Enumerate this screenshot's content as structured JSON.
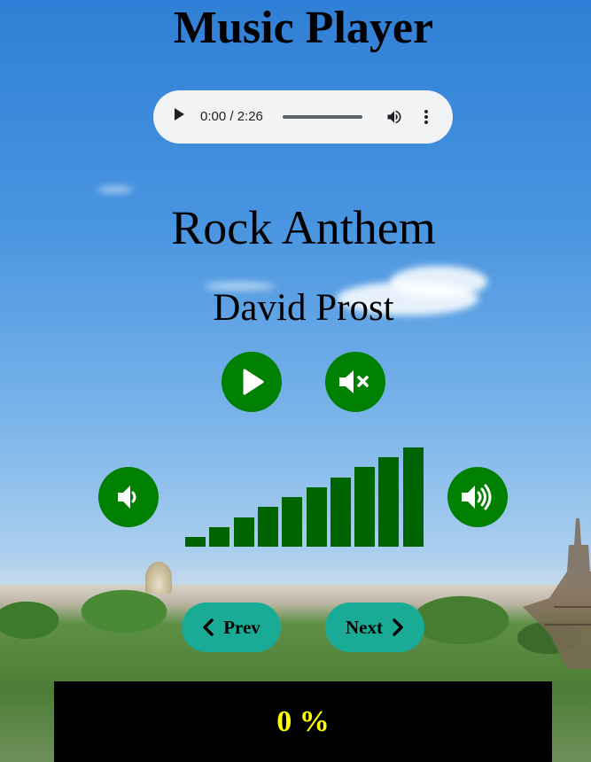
{
  "header": {
    "title": "Music Player"
  },
  "audio_player": {
    "time_display": "0:00 / 2:26",
    "controls": [
      "play-icon",
      "seek-slider",
      "volume-icon",
      "more-options-icon"
    ]
  },
  "track": {
    "title": "Rock Anthem",
    "artist": "David Prost"
  },
  "controls": {
    "play_icon": "play-icon",
    "mute_icon": "volume-mute-icon",
    "volume_down_icon": "volume-down-icon",
    "volume_up_icon": "volume-up-icon",
    "button_color": "#008000"
  },
  "volume_meter": {
    "levels": 10,
    "bar_color": "#006400"
  },
  "navigation": {
    "prev_label": "Prev",
    "next_label": "Next",
    "button_color": "#1aab96"
  },
  "progress": {
    "text": "0 %",
    "text_color": "#ffff00",
    "background": "#000000"
  }
}
